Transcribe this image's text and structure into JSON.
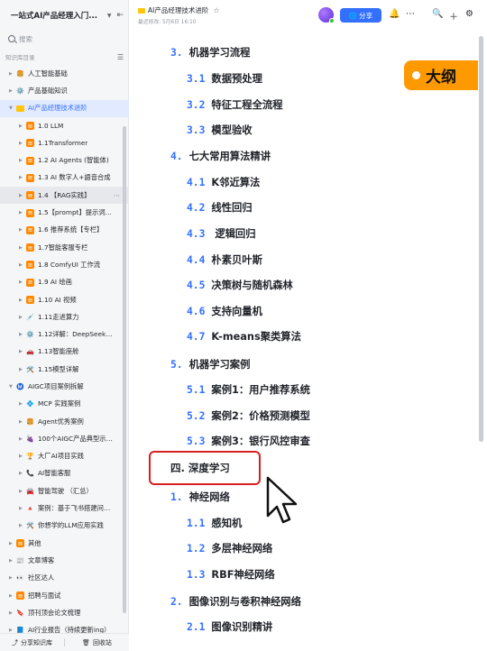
{
  "sidebar": {
    "title": "一站式AI产品经理入门...",
    "search_placeholder": "搜索",
    "section_label": "知识库目录",
    "items": [
      {
        "label": "人工智能基础",
        "level": 0,
        "icon": "🍔"
      },
      {
        "label": "产品基础知识",
        "level": 0,
        "icon": "⚙️"
      },
      {
        "label": "AI产品经理技术进阶",
        "level": 0,
        "icon": "folder",
        "active": true
      },
      {
        "label": "1.0 LLM",
        "level": 1,
        "icon": "doc"
      },
      {
        "label": "1.1Transformer",
        "level": 1,
        "icon": "doc"
      },
      {
        "label": "1.2 AI Agents (智能体)",
        "level": 1,
        "icon": "doc"
      },
      {
        "label": "1.3 AI 数字人+語音合成",
        "level": 1,
        "icon": "doc"
      },
      {
        "label": "1.4 【RAG实践】",
        "level": 1,
        "icon": "doc",
        "hover": true
      },
      {
        "label": "1.5【prompt】提示词工程",
        "level": 1,
        "icon": "doc"
      },
      {
        "label": "1.6 推荐系统【专栏】",
        "level": 1,
        "icon": "doc"
      },
      {
        "label": "1.7智能客服专栏",
        "level": 1,
        "icon": "doc"
      },
      {
        "label": "1.8 ComfyUI 工作流",
        "level": 1,
        "icon": "doc"
      },
      {
        "label": "1.9 AI 绘画",
        "level": 1,
        "icon": "doc"
      },
      {
        "label": "1.10 AI 视频",
        "level": 1,
        "icon": "doc"
      },
      {
        "label": "1.11走进算力",
        "level": 1,
        "icon": "💉"
      },
      {
        "label": "1.12详解：DeepSeek深...",
        "level": 1,
        "icon": "⚙️"
      },
      {
        "label": "1.13智能座舱",
        "level": 1,
        "icon": "🚗"
      },
      {
        "label": "1.15模型详解",
        "level": 1,
        "icon": "🛠️"
      },
      {
        "label": "AIGC项目案例拆解",
        "level": 0,
        "icon": "Ⓜ️"
      },
      {
        "label": "MCP 实践案例",
        "level": 1,
        "icon": "💠"
      },
      {
        "label": "Agent优秀案例",
        "level": 1,
        "icon": "🍔"
      },
      {
        "label": "100个AIGC产品典型示范...",
        "level": 1,
        "icon": "🍇"
      },
      {
        "label": "大厂AI项目实践",
        "level": 1,
        "icon": "🏆"
      },
      {
        "label": "AI智能客服",
        "level": 1,
        "icon": "📞"
      },
      {
        "label": "智能驾驶 （汇总）",
        "level": 1,
        "icon": "🚘"
      },
      {
        "label": "案例：基于飞书搭建问答...",
        "level": 1,
        "icon": "🔺"
      },
      {
        "label": "你想学的LLM应用实践",
        "level": 1,
        "icon": "🛠️"
      },
      {
        "label": "其他",
        "level": 0,
        "icon": "doc"
      },
      {
        "label": "文章博客",
        "level": 0,
        "icon": "📰"
      },
      {
        "label": "社区达人",
        "level": 0,
        "icon": "👀"
      },
      {
        "label": "招聘与面试",
        "level": 0,
        "icon": "doc"
      },
      {
        "label": "顶刊顶会论文梳理",
        "level": 0,
        "icon": "🔖"
      },
      {
        "label": "AI行业报告（持续更新ing）",
        "level": 0,
        "icon": "📘"
      }
    ],
    "bottom": {
      "share_label": "分享知识库",
      "recycle_label": "回收站"
    }
  },
  "header": {
    "doc_title": "AI产品经理技术进阶",
    "meta": "最近修改: 5月6日 16:10",
    "share_label": "分享"
  },
  "badge": {
    "text": "大纲"
  },
  "outline": [
    {
      "num": "3.",
      "text": "机器学习流程",
      "level": 1
    },
    {
      "num": "3.1",
      "text": "数据预处理",
      "level": 2
    },
    {
      "num": "3.2",
      "text": "特征工程全流程",
      "level": 2
    },
    {
      "num": "3.3",
      "text": "模型验收",
      "level": 2
    },
    {
      "num": "4.",
      "text": "七大常用算法精讲",
      "level": 1
    },
    {
      "num": "4.1",
      "text": "K邻近算法",
      "level": 2
    },
    {
      "num": "4.2",
      "text": "线性回归",
      "level": 2
    },
    {
      "num": "4.3",
      "text": " 逻辑回归",
      "level": 2
    },
    {
      "num": "4.4",
      "text": "朴素贝叶斯",
      "level": 2
    },
    {
      "num": "4.5",
      "text": "决策树与随机森林",
      "level": 2
    },
    {
      "num": "4.6",
      "text": "支持向量机",
      "level": 2
    },
    {
      "num": "4.7",
      "text": "K-means聚类算法",
      "level": 2
    },
    {
      "num": "5.",
      "text": "机器学习案例",
      "level": 1
    },
    {
      "num": "5.1",
      "text": "案例1：用户推荐系统",
      "level": 2
    },
    {
      "num": "5.2",
      "text": "案例2：价格预测模型",
      "level": 2
    },
    {
      "num": "5.3",
      "text": "案例3：银行风控审查",
      "level": 2
    },
    {
      "num": "1.",
      "text": "神经网络",
      "level": 1
    },
    {
      "num": "1.1",
      "text": "感知机",
      "level": 2
    },
    {
      "num": "1.2",
      "text": "多层神经网络",
      "level": 2
    },
    {
      "num": "1.3",
      "text": "RBF神经网络",
      "level": 2
    },
    {
      "num": "2.",
      "text": "图像识别与卷积神经网络",
      "level": 1
    },
    {
      "num": "2.1",
      "text": "图像识别精讲",
      "level": 2
    }
  ],
  "highlighted_heading": "四. 深度学习",
  "colors": {
    "accent": "#3370ff",
    "highlight_border": "#d61f1f",
    "badge": "#ff9900"
  }
}
